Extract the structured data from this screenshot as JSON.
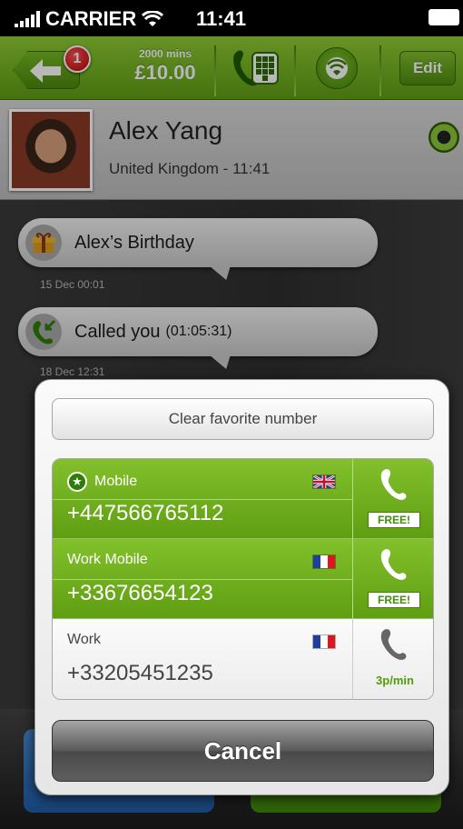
{
  "status_bar": {
    "carrier": "CARRIER",
    "time": "11:41"
  },
  "toolbar": {
    "badge_count": "1",
    "credit_minutes": "2000 mins",
    "credit_amount": "£10.00",
    "edit_label": "Edit",
    "accent_color": "#6aaa1c"
  },
  "contact": {
    "name": "Alex Yang",
    "subtitle": "United Kingdom - 11:41",
    "presence": "online"
  },
  "history": [
    {
      "text": "Alex’s Birthday",
      "detail": "",
      "timestamp": "15 Dec 00:01",
      "icon": "gift-icon"
    },
    {
      "text": "Called you",
      "detail": "(01:05:31)",
      "timestamp": "18 Dec 12:31",
      "icon": "incoming-call-icon"
    }
  ],
  "popup": {
    "clear_label": "Clear favorite number",
    "cancel_label": "Cancel",
    "numbers": [
      {
        "label": "Mobile",
        "number": "+447566765112",
        "country": "UK",
        "price": "FREE!",
        "favorite": true,
        "highlighted": true
      },
      {
        "label": "Work Mobile",
        "number": "+33676654123",
        "country": "FR",
        "price": "FREE!",
        "favorite": false,
        "highlighted": true
      },
      {
        "label": "Work",
        "number": "+33205451235",
        "country": "FR",
        "price": "3p/min",
        "favorite": false,
        "highlighted": false
      }
    ]
  }
}
